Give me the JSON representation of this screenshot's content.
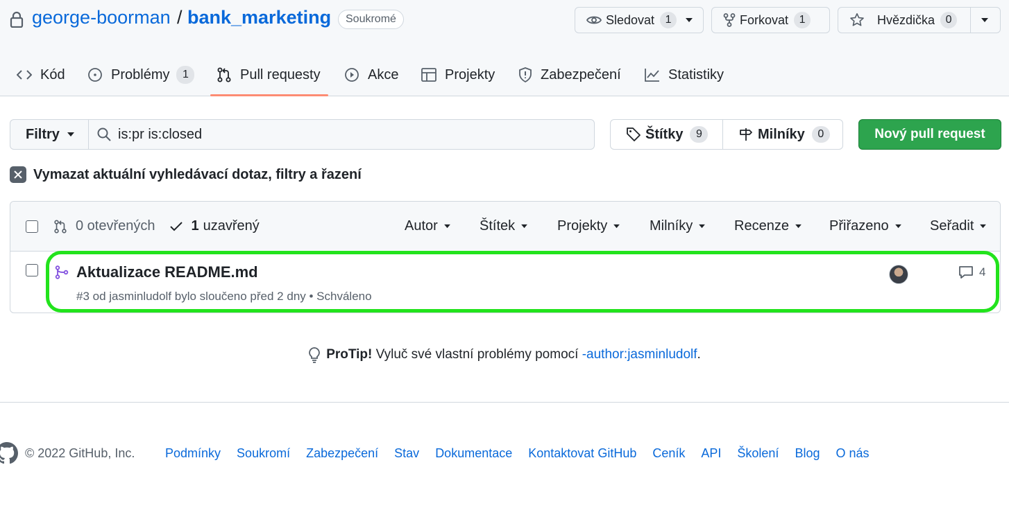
{
  "repo": {
    "owner": "george-boorman",
    "separator": "/",
    "name": "bank_marketing",
    "visibility": "Soukromé"
  },
  "header_actions": {
    "watch": {
      "label": "Sledovat",
      "count": "1"
    },
    "fork": {
      "label": "Forkovat",
      "count": "1"
    },
    "star": {
      "label": "Hvězdička",
      "count": "0"
    }
  },
  "tabs": [
    {
      "label": "Kód",
      "icon": "code-icon"
    },
    {
      "label": "Problémy",
      "icon": "issue-icon",
      "count": "1"
    },
    {
      "label": "Pull requesty",
      "icon": "pull-request-icon",
      "selected": true
    },
    {
      "label": "Akce",
      "icon": "play-icon"
    },
    {
      "label": "Projekty",
      "icon": "table-icon"
    },
    {
      "label": "Zabezpečení",
      "icon": "shield-icon"
    },
    {
      "label": "Statistiky",
      "icon": "graph-icon"
    }
  ],
  "filters": {
    "button_label": "Filtry",
    "search_value": "is:pr is:closed",
    "labels": {
      "label": "Štítky",
      "count": "9"
    },
    "milestones": {
      "label": "Milníky",
      "count": "0"
    },
    "new_pr_label": "Nový pull request",
    "clear_label": "Vymazat aktuální vyhledávací dotaz, filtry a řazení"
  },
  "list_header": {
    "open_label": "0 otevřených",
    "closed_count": "1",
    "closed_label": "uzavřený",
    "sorts": [
      "Autor",
      "Štítek",
      "Projekty",
      "Milníky",
      "Recenze",
      "Přiřazeno",
      "Seřadit"
    ]
  },
  "pull_requests": [
    {
      "title": "Aktualizace README.md",
      "meta": "#3 od jasminludolf bylo sloučeno před 2 dny • Schváleno",
      "comments": "4",
      "state": "merged"
    }
  ],
  "protip": {
    "bold": "ProTip!",
    "text": "Vyluč své vlastní problémy pomocí",
    "link": "-author:jasminludolf",
    "end": "."
  },
  "footer": {
    "copyright": "© 2022 GitHub, Inc.",
    "links": [
      "Podmínky",
      "Soukromí",
      "Zabezpečení",
      "Stav",
      "Dokumentace",
      "Kontaktovat GitHub",
      "Ceník",
      "API",
      "Školení",
      "Blog",
      "O nás"
    ]
  },
  "colors": {
    "link": "#0969da",
    "primary_button": "#2da44e",
    "merged": "#8250df",
    "highlight": "#22e31c",
    "tab_underline": "#fd8c73"
  }
}
